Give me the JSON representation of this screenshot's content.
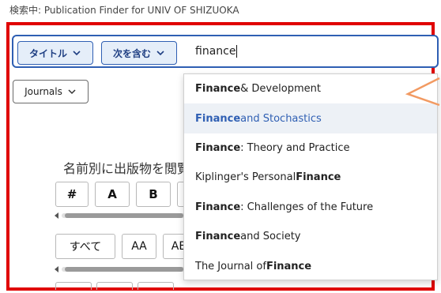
{
  "caption": "検索中: Publication Finder for UNIV OF SHIZUOKA",
  "search": {
    "field_label": "タイトル",
    "operator_label": "次を含む",
    "query": "finance"
  },
  "filter": {
    "journals_label": "Journals"
  },
  "browse": {
    "title": "名前別に出版物を閲覧",
    "row1_keys": [
      "#",
      "A",
      "B"
    ],
    "row2_keys": [
      "すべて",
      "AA",
      "AE"
    ]
  },
  "suggestions": [
    {
      "bold": "Finance",
      "rest": " & Development",
      "bold_first": true
    },
    {
      "bold": "Finance",
      "rest": " and Stochastics",
      "bold_first": true
    },
    {
      "bold": "Finance",
      "rest": ": Theory and Practice",
      "bold_first": true
    },
    {
      "bold": "Finance",
      "rest": "Kiplinger's Personal ",
      "bold_first": false
    },
    {
      "bold": "Finance",
      "rest": " : Challenges of the Future",
      "bold_first": true
    },
    {
      "bold": "Finance",
      "rest": " and Society",
      "bold_first": true
    },
    {
      "bold": "Finance",
      "rest": "The Journal of ",
      "bold_first": false
    }
  ],
  "active_suggestion_index": 1,
  "icons": {
    "field_dropdown": "chevron-down-icon",
    "operator_dropdown": "chevron-down-icon",
    "journals_dropdown": "chevron-down-icon"
  },
  "colors": {
    "accent": "#2f5fb3",
    "highlight_frame": "#e00000",
    "annotation": "#f29a62",
    "active_row_bg": "#edf1f6"
  }
}
